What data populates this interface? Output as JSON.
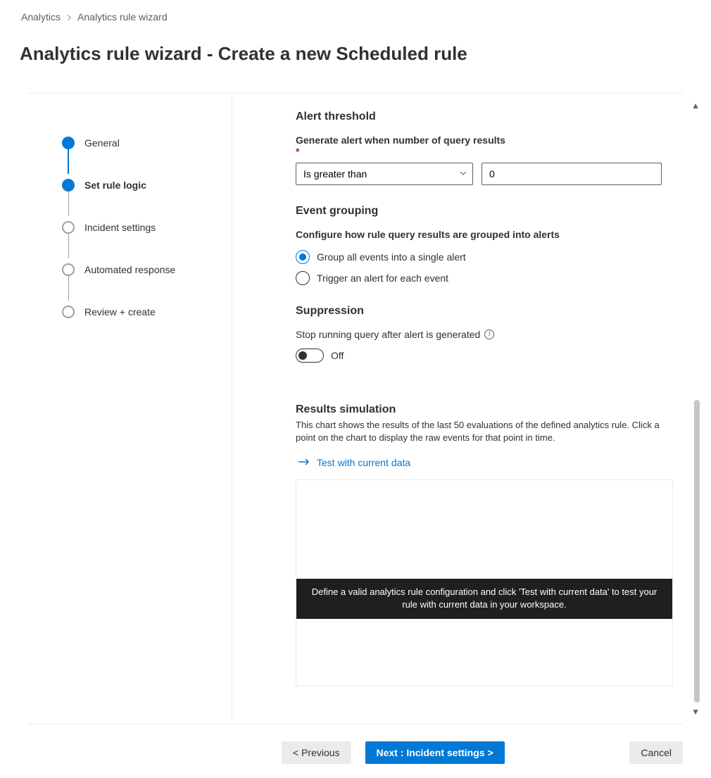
{
  "breadcrumb": {
    "root": "Analytics",
    "current": "Analytics rule wizard"
  },
  "title": "Analytics rule wizard - Create a new Scheduled rule",
  "steps": [
    {
      "label": "General",
      "state": "done"
    },
    {
      "label": "Set rule logic",
      "state": "active"
    },
    {
      "label": "Incident settings",
      "state": "pending"
    },
    {
      "label": "Automated response",
      "state": "pending"
    },
    {
      "label": "Review + create",
      "state": "pending"
    }
  ],
  "alert_threshold": {
    "heading": "Alert threshold",
    "label": "Generate alert when number of query results",
    "operator": "Is greater than",
    "value": "0"
  },
  "event_grouping": {
    "heading": "Event grouping",
    "desc": "Configure how rule query results are grouped into alerts",
    "options": [
      {
        "label": "Group all events into a single alert",
        "selected": true
      },
      {
        "label": "Trigger an alert for each event",
        "selected": false
      }
    ]
  },
  "suppression": {
    "heading": "Suppression",
    "label": "Stop running query after alert is generated",
    "toggleState": "Off"
  },
  "simulation": {
    "heading": "Results simulation",
    "desc": "This chart shows the results of the last 50 evaluations of the defined analytics rule. Click a point on the chart to display the raw events for that point in time.",
    "testLink": "Test with current data",
    "banner": "Define a valid analytics rule configuration and click 'Test with current data' to test your rule with current data in your workspace."
  },
  "footer": {
    "previous": "< Previous",
    "next": "Next : Incident settings >",
    "cancel": "Cancel"
  }
}
